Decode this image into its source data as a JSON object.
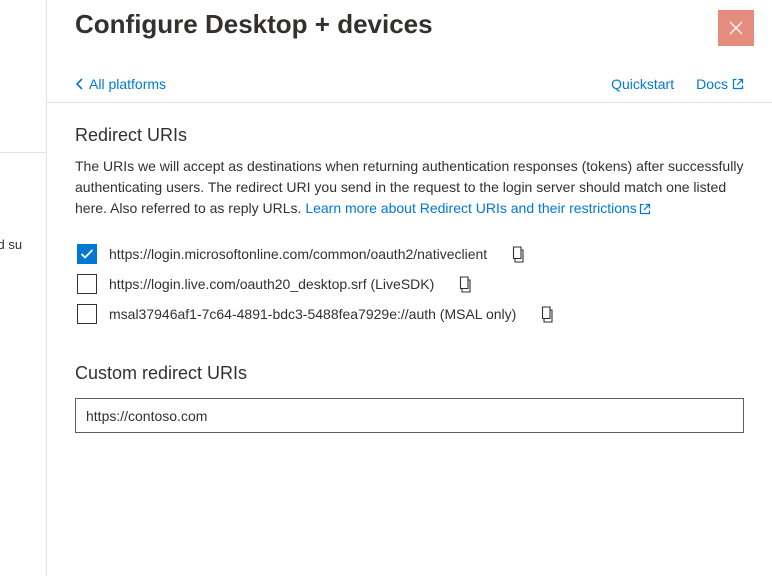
{
  "header": {
    "title": "Configure Desktop + devices"
  },
  "nav": {
    "back": "All platforms",
    "quickstart": "Quickstart",
    "docs": "Docs"
  },
  "redirect": {
    "title": "Redirect URIs",
    "desc_part1": "The URIs we will accept as destinations when returning authentication responses (tokens) after successfully authenticating users. The redirect URI you send in the request to the login server should match one listed here. Also referred to as reply URLs. ",
    "learn_more": "Learn more about Redirect URIs and their restrictions",
    "items": [
      {
        "label": "https://login.microsoftonline.com/common/oauth2/nativeclient",
        "checked": true
      },
      {
        "label": "https://login.live.com/oauth20_desktop.srf (LiveSDK)",
        "checked": false
      },
      {
        "label": "msal37946af1-7c64-4891-bdc3-5488fea7929e://auth (MSAL only)",
        "checked": false
      }
    ]
  },
  "custom": {
    "title": "Custom redirect URIs",
    "value": "https://contoso.com"
  },
  "bg": {
    "cutoff": "red  su"
  }
}
